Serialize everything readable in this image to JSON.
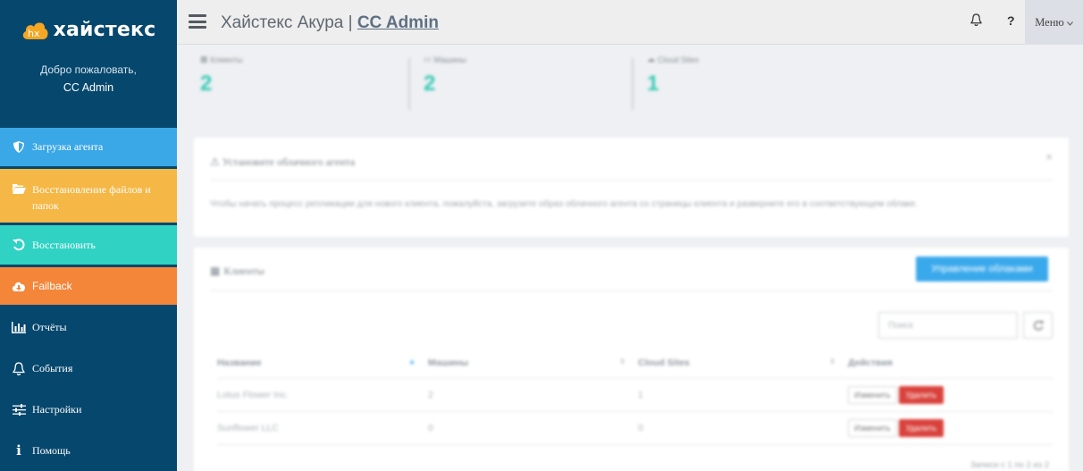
{
  "brand": {
    "logo_mark": "hx",
    "logo_text": "хайстекс"
  },
  "welcome": {
    "greeting": "Добро пожаловать,",
    "user": "CC Admin"
  },
  "nav": {
    "download_agent": "Загрузка агента",
    "restore_files": "Восстановление файлов и папок",
    "restore": "Восстановить",
    "failback": "Failback",
    "reports": "Отчёты",
    "events": "События",
    "settings": "Настройки",
    "help": "Помощь"
  },
  "header": {
    "title_prefix": "Хайстекс Акура | ",
    "title_admin": "CC Admin",
    "help": "?",
    "menu": "Меню"
  },
  "stats": [
    {
      "label": "Клиенты",
      "value": "2"
    },
    {
      "label": "Машины",
      "value": "2"
    },
    {
      "label": "Cloud Sites",
      "value": "1"
    }
  ],
  "install_card": {
    "title": "Установите облачного агента",
    "close": "×",
    "text": "Чтобы начать процесс репликации для нового клиента, пожалуйста, загрузите образ облачного агента со страницы клиента и разверните его в соответствующем облаке."
  },
  "clients_card": {
    "title": "Клиенты",
    "manage_button": "Управление облаками",
    "search_placeholder": "Поиск",
    "columns": [
      "Название",
      "Машины",
      "Cloud Sites",
      "Действия"
    ],
    "rows": [
      {
        "name": "Lotus Flower Inc.",
        "machines": "2",
        "sites": "1"
      },
      {
        "name": "Sunflower LLC",
        "machines": "0",
        "sites": "0"
      }
    ],
    "edit_label": "Изменить",
    "delete_label": "Удалить",
    "records": "Записи с 1 по 2 из 2"
  },
  "colors": {
    "sidebar": "#06476d",
    "download": "#3aa7e6",
    "restore_files": "#f5b745",
    "restore": "#2fd2c3",
    "failback": "#f4863a",
    "stat_value": "#35c9b4"
  }
}
